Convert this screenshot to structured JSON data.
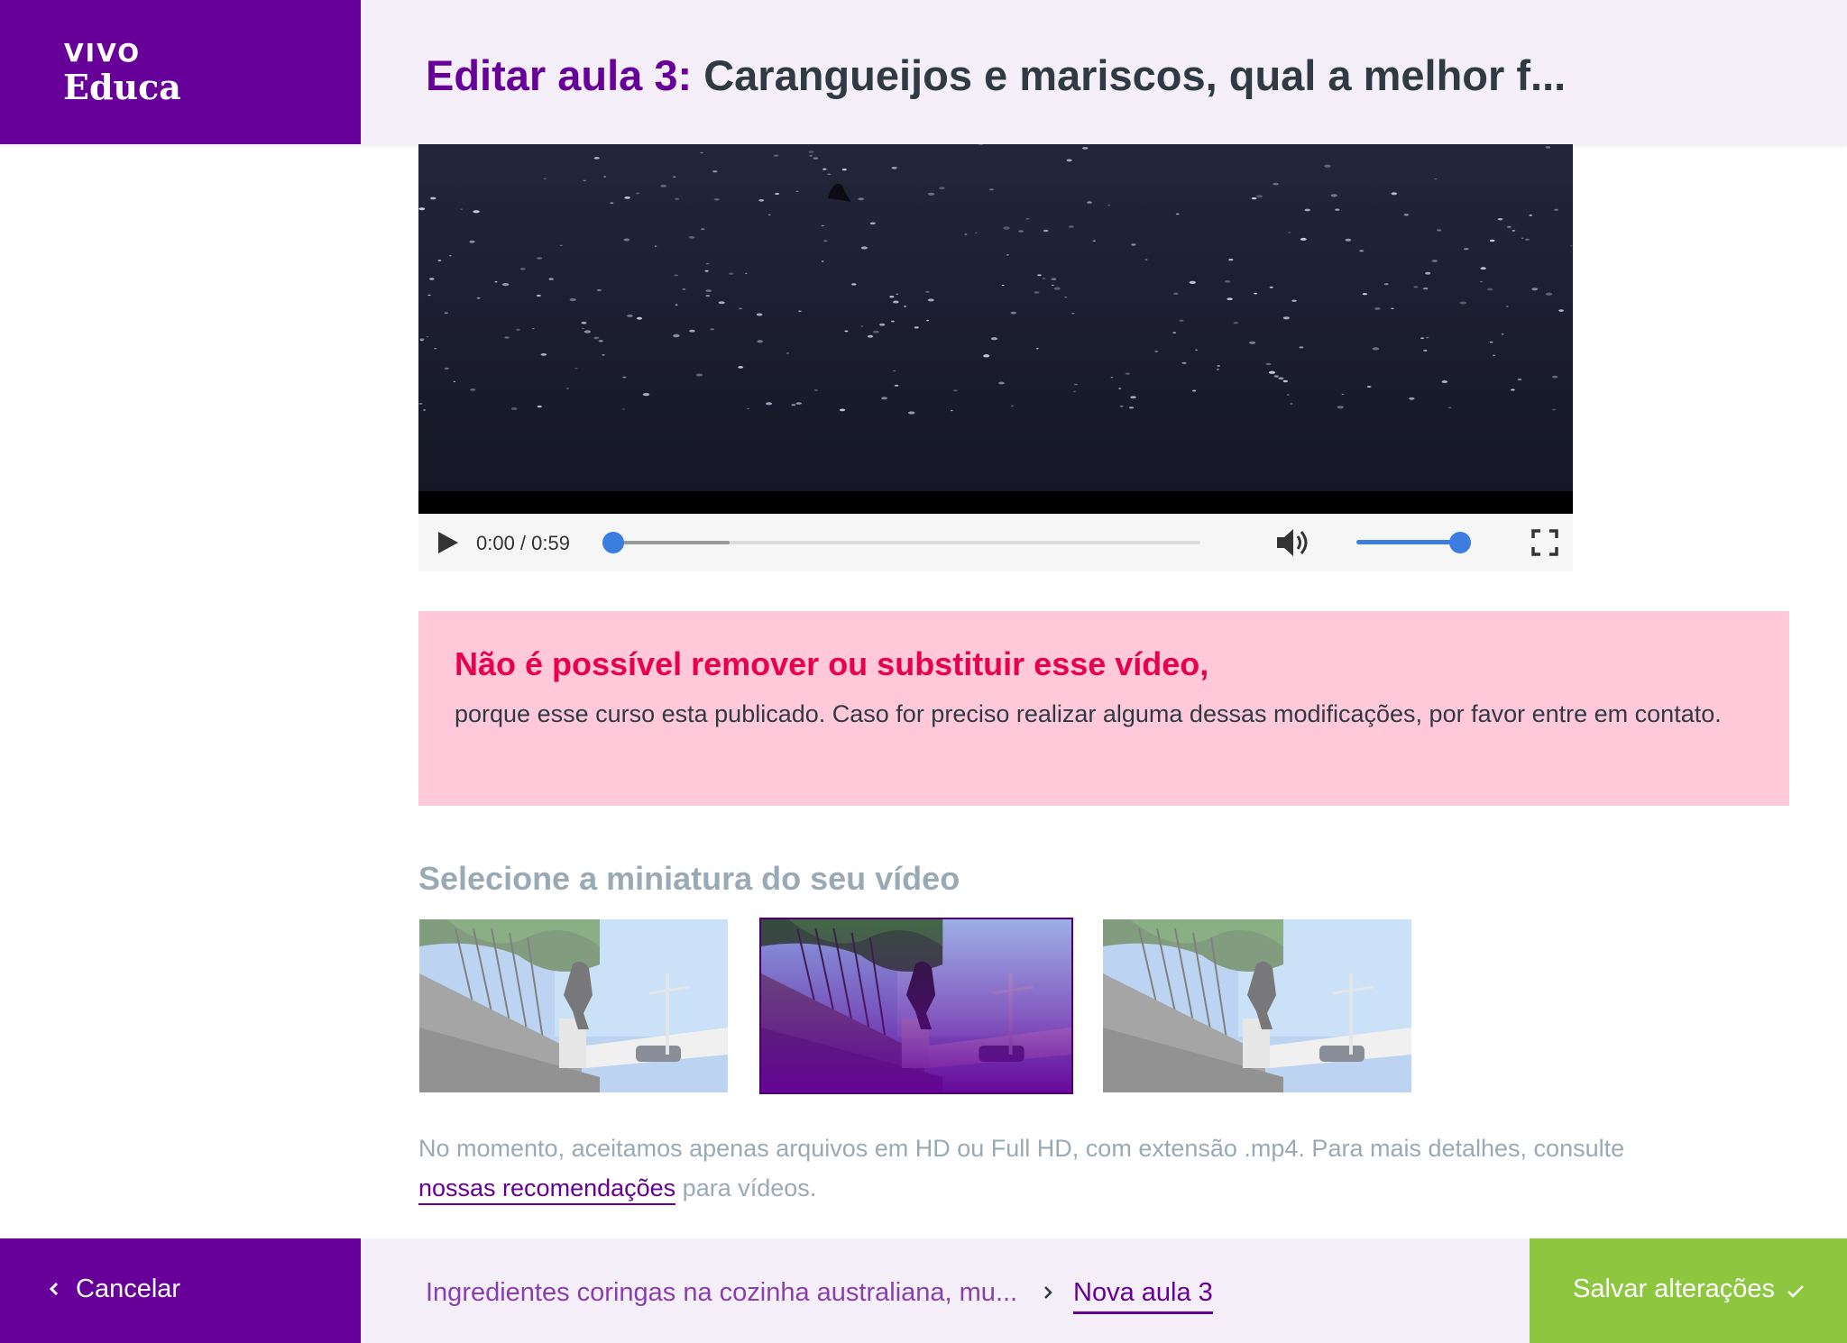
{
  "brand": {
    "line1": "VIVO",
    "line2": "Educa",
    "color": "#660099"
  },
  "header": {
    "title_prefix": "Editar aula 3:",
    "title_rest": " Carangueijos e mariscos, qual a melhor f..."
  },
  "video": {
    "time": "0:00 / 0:59",
    "progress": 0,
    "buffered": 0.2,
    "volume": 1.0,
    "icons": [
      "play-icon",
      "volume-icon",
      "fullscreen-icon"
    ]
  },
  "alert": {
    "title": "Não é possível remover ou substituir esse vídeo,",
    "body": "porque esse curso esta publicado. Caso for preciso realizar alguma dessas modificações, por favor entre em contato.",
    "title_color": "#e8004c",
    "background": "#ffc9da"
  },
  "thumbnails": {
    "title": "Selecione a miniatura do seu vídeo",
    "selected_index": 1,
    "count": 3
  },
  "hint": {
    "before": "No momento, aceitamos apenas arquivos em HD ou Full HD, com extensão .mp4. Para mais detalhes, consulte ",
    "link": "nossas recomendações",
    "after": " para vídeos."
  },
  "footer": {
    "cancel_label": "Cancelar",
    "breadcrumb_prev": "Ingredientes coringas na cozinha australiana, mu...",
    "breadcrumb_current": "Nova aula 3",
    "save_label": "Salvar alterações",
    "save_color": "#8dc63f"
  }
}
